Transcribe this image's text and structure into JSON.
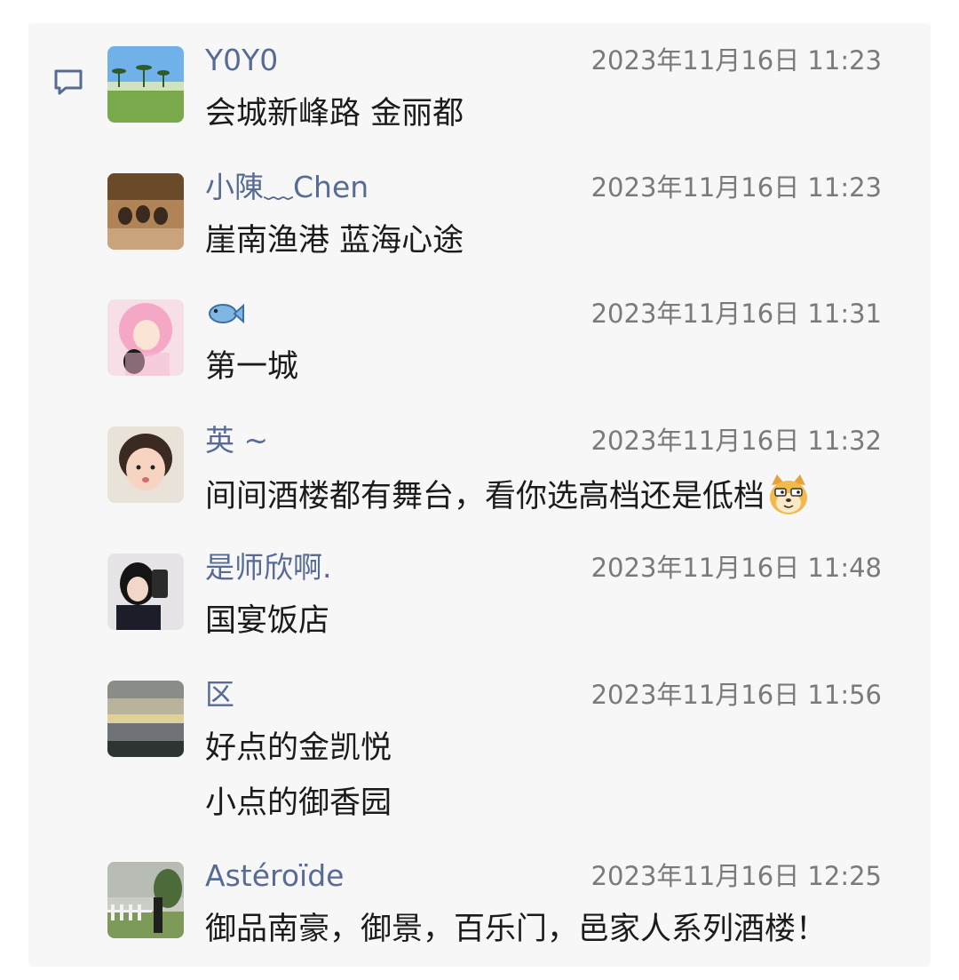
{
  "comments": [
    {
      "name": "Y0Y0",
      "time": "2023年11月16日 11:23",
      "lines": [
        "会城新峰路  金丽都"
      ],
      "avatar_icon": "palm-beach-avatar"
    },
    {
      "name": "小陳﹏Chen",
      "time": "2023年11月16日 11:23",
      "lines": [
        "崖南渔港 蓝海心途"
      ],
      "avatar_icon": "dogs-avatar"
    },
    {
      "name": "",
      "name_emoji": "fish-emoji",
      "time": "2023年11月16日 11:31",
      "lines": [
        "第一城"
      ],
      "avatar_icon": "pink-hair-girl-avatar"
    },
    {
      "name": "英 ~",
      "time": "2023年11月16日 11:32",
      "lines": [
        "间间酒楼都有舞台，看你选高档还是低档"
      ],
      "line_emoji": "doge-emoji",
      "avatar_icon": "child-avatar"
    },
    {
      "name": "是师欣啊.",
      "time": "2023年11月16日 11:48",
      "lines": [
        "国宴饭店"
      ],
      "avatar_icon": "selfie-girl-avatar"
    },
    {
      "name": "区",
      "time": "2023年11月16日 11:56",
      "lines": [
        "好点的金凯悦",
        "小点的御香园"
      ],
      "avatar_icon": "sunset-sky-avatar"
    },
    {
      "name": "Astéroïde",
      "time": "2023年11月16日 12:25",
      "lines": [
        "御品南豪，御景，百乐门，邑家人系列酒楼！"
      ],
      "avatar_icon": "garden-avatar"
    }
  ],
  "colors": {
    "name": "#576b95",
    "time": "#7a7a7a",
    "text": "#1b1b1b",
    "panel": "#f7f7f7"
  }
}
